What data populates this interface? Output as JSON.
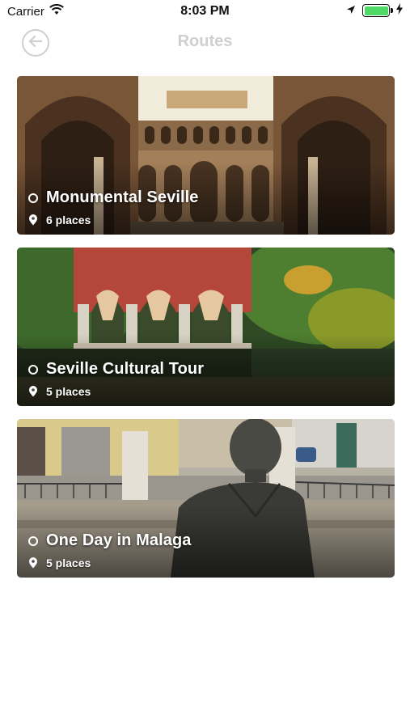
{
  "status_bar": {
    "carrier": "Carrier",
    "time": "8:03 PM",
    "icons": [
      "wifi-icon",
      "location-arrow-icon",
      "battery-icon",
      "charging-bolt-icon"
    ]
  },
  "nav": {
    "title": "Routes",
    "back_icon": "arrow-left-icon"
  },
  "routes": [
    {
      "name": "Monumental Seville",
      "places": "6 places",
      "image": "palace-courtyard-arches"
    },
    {
      "name": "Seville Cultural Tour",
      "places": "5 places",
      "image": "garden-pavilion-pond"
    },
    {
      "name": "One Day in Malaga",
      "places": "5 places",
      "image": "statue-in-plaza"
    }
  ],
  "colors": {
    "accent_inactive": "#cfcfcf",
    "battery": "#4cd964",
    "overlay_text": "#ffffff"
  }
}
